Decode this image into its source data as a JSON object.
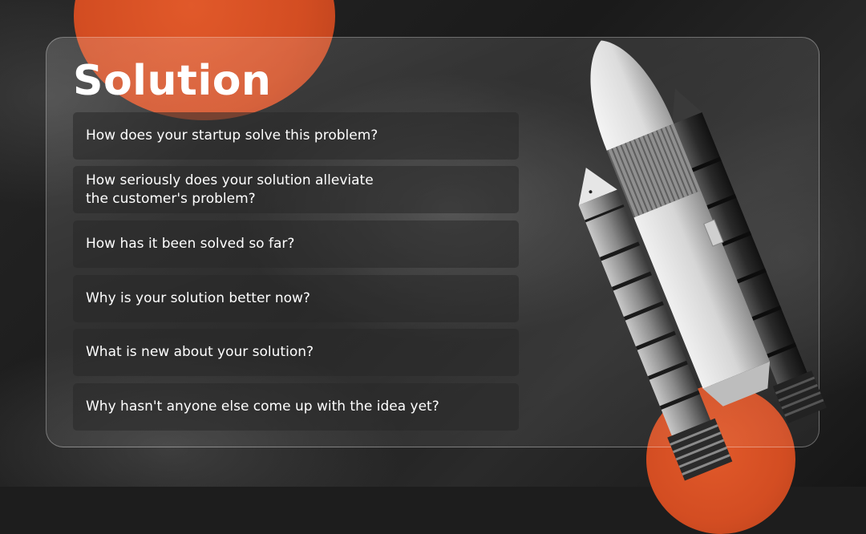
{
  "slide": {
    "title": "Solution",
    "items": [
      {
        "line1": "How does your startup solve this problem?",
        "line2": ""
      },
      {
        "line1": "How seriously does your solution alleviate",
        "line2": "the customer's problem?"
      },
      {
        "line1": "How has it been solved so far?",
        "line2": ""
      },
      {
        "line1": "Why is your solution better now?",
        "line2": ""
      },
      {
        "line1": "What is new about your solution?",
        "line2": ""
      },
      {
        "line1": "Why hasn't anyone else come up with the idea yet?",
        "line2": ""
      }
    ]
  },
  "colors": {
    "accent": "#d8522a",
    "background": "#1d1d1d",
    "text": "#ffffff"
  },
  "illustration": "space-shuttle-rocket"
}
